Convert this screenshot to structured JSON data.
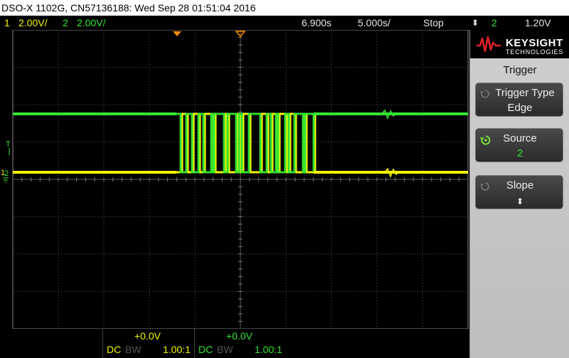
{
  "title_bar": {
    "text": "DSO-X 1102G, CN57136188: Wed Sep 28 01:51:04 2016"
  },
  "status_bar": {
    "ch1_num": "1",
    "ch1_scale": "2.00V/",
    "ch2_num": "2",
    "ch2_scale": "2.00V/",
    "time_delay": "6.900s",
    "time_base": "5.000s/",
    "run_state": "Stop",
    "trigger_source_num": "2",
    "trigger_level": "1.20V"
  },
  "logo": {
    "brand": "KEYSIGHT",
    "sub": "TECHNOLOGIES"
  },
  "right_panel": {
    "menu_title": "Trigger",
    "softkeys": [
      {
        "label": "Trigger Type",
        "value": "Edge"
      },
      {
        "label": "Source",
        "value": "2"
      },
      {
        "label": "Slope",
        "value": "⬍"
      }
    ]
  },
  "markers": {
    "trigger_marker": "T",
    "ch1_marker": "1",
    "ch2_marker": "2"
  },
  "bottom": {
    "ch1": {
      "offset": "+0.0V",
      "coupling": "DC",
      "bw": "BW",
      "probe": "1.00:1"
    },
    "ch2": {
      "offset": "+0.0V",
      "coupling": "DC",
      "bw": "BW",
      "probe": "1.00:1"
    }
  },
  "colors": {
    "ch1": "#f5f500",
    "ch2": "#33e633",
    "trigger_marker": "#ff8c00",
    "grid": "#5a5a5a"
  }
}
